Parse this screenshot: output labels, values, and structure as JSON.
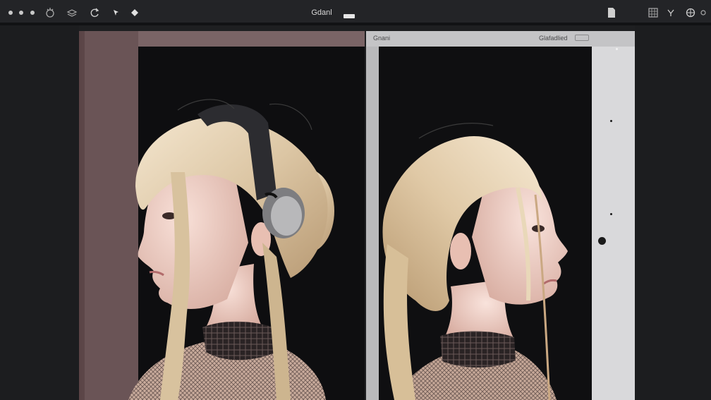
{
  "toolbar": {
    "title": "Gdanl",
    "left_tools": [
      {
        "icon": "window-dot-icon"
      },
      {
        "icon": "window-dot-icon"
      },
      {
        "icon": "window-dot-icon"
      },
      {
        "icon": "brush-settings-icon"
      },
      {
        "icon": "layers-tool-icon"
      },
      {
        "icon": "rotate-tool-icon"
      },
      {
        "icon": "cursor-tool-icon"
      },
      {
        "icon": "diamond-tool-icon"
      }
    ],
    "right_tools": [
      {
        "icon": "document-icon"
      },
      {
        "icon": "grid-icon"
      },
      {
        "icon": "filter-icon"
      },
      {
        "icon": "globe-icon"
      },
      {
        "icon": "gear-icon"
      }
    ]
  },
  "compare_view": {
    "left_label": "Gnani",
    "right_label": "Glafadlied"
  },
  "colors": {
    "toolbar_bg": "#232427",
    "canvas_bg": "#1e1f21",
    "left_panel_frame": "#7a6466",
    "right_panel_frame": "#cfcfd1",
    "hair": "#e3d2b6",
    "skin": "#f0d2c8"
  }
}
